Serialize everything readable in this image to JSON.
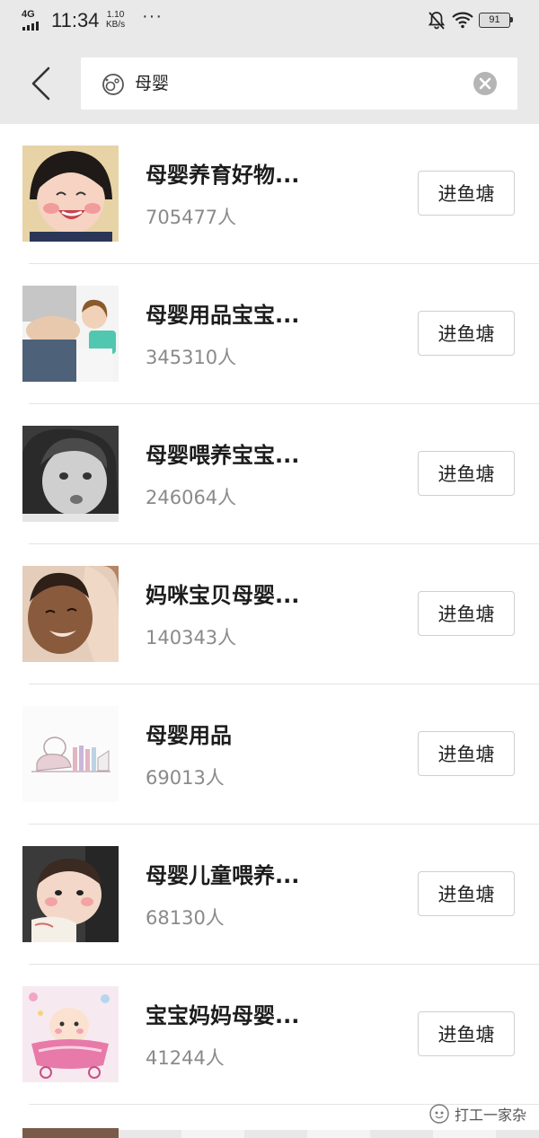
{
  "status_bar": {
    "network": "4G",
    "time": "11:34",
    "speed_value": "1.10",
    "speed_unit": "KB/s",
    "more": "···",
    "battery": "91"
  },
  "search": {
    "query": "母婴"
  },
  "join_label": "进鱼塘",
  "items": [
    {
      "name": "母婴养育好物...",
      "members": "705477人",
      "thumb": "smiling-toddler"
    },
    {
      "name": "母婴用品宝宝...",
      "members": "345310人",
      "thumb": "pregnant-mother-child"
    },
    {
      "name": "母婴喂养宝宝...",
      "members": "246064人",
      "thumb": "baby-bw-photo"
    },
    {
      "name": "妈咪宝贝母婴...",
      "members": "140343人",
      "thumb": "mother-baby-cheek"
    },
    {
      "name": "母婴用品",
      "members": "69013人",
      "thumb": "baby-sketch"
    },
    {
      "name": "母婴儿童喂养...",
      "members": "68130人",
      "thumb": "infant-face"
    },
    {
      "name": "宝宝妈妈母婴...",
      "members": "41244人",
      "thumb": "baby-cartoon"
    }
  ],
  "watermark": {
    "text": "打工一家杂"
  },
  "colors": {
    "header_bg": "#e9e9e9",
    "divider": "#e4e4e4",
    "count_text": "#8a8a8a",
    "button_border": "#cfcfcf"
  }
}
